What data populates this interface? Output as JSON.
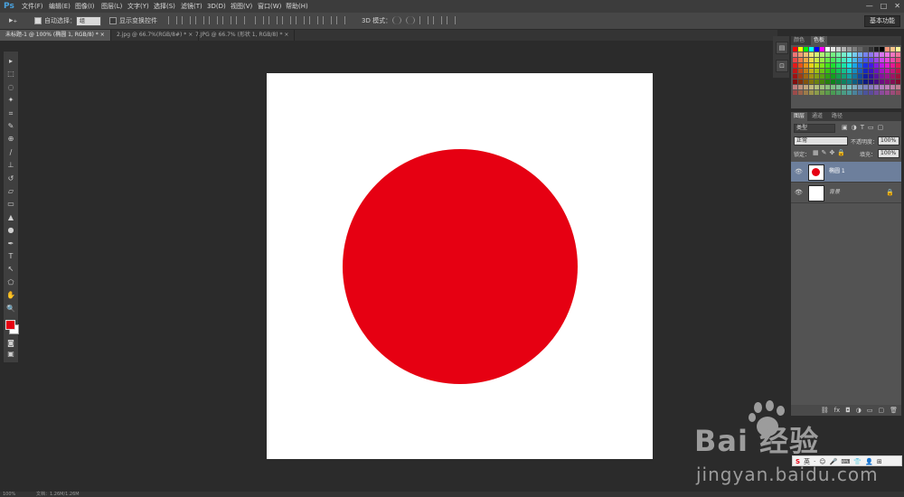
{
  "app": {
    "logo": "Ps",
    "menu": [
      "文件(F)",
      "编辑(E)",
      "图像(I)",
      "图层(L)",
      "文字(Y)",
      "选择(S)",
      "滤镜(T)",
      "3D(D)",
      "视图(V)",
      "窗口(W)",
      "帮助(H)"
    ],
    "window_controls": [
      "—",
      "□",
      "✕"
    ]
  },
  "options_bar": {
    "auto_select_label": "自动选择：",
    "auto_select_value": "组",
    "show_transform_label": "显示变换控件",
    "mode_3d_label": "3D 模式：",
    "workspace": "基本功能"
  },
  "tabs": [
    {
      "label": "未标题-1 @ 100% (椭圆 1, RGB/8) *",
      "close": "×",
      "active": true
    },
    {
      "label": "2.jpg @ 66.7%(RGB/8#) *",
      "close": "×",
      "active": false
    },
    {
      "label": "7.JPG @ 66.7% (形状 1, RGB/8) *",
      "close": "×",
      "active": false
    }
  ],
  "tools": [
    "move-tool",
    "marquee-tool",
    "lasso-tool",
    "magic-wand-tool",
    "crop-tool",
    "eyedropper-tool",
    "healing-brush-tool",
    "brush-tool",
    "clone-stamp-tool",
    "history-brush-tool",
    "eraser-tool",
    "gradient-tool",
    "blur-tool",
    "dodge-tool",
    "pen-tool",
    "type-tool",
    "path-selection-tool",
    "shape-tool",
    "hand-tool",
    "zoom-tool"
  ],
  "tool_glyphs": [
    "▸",
    "⬚",
    "◌",
    "✦",
    "⌗",
    "✎",
    "⊕",
    "∕",
    "⊥",
    "↺",
    "▱",
    "▭",
    "▲",
    "●",
    "✒",
    "T",
    "↖",
    "⬠",
    "✋",
    "🔍"
  ],
  "colors": {
    "foreground": "#e60012",
    "background": "#ffffff",
    "circle": "#e60012"
  },
  "color_panel": {
    "tabs": [
      "颜色",
      "色板"
    ],
    "active_tab": "色板"
  },
  "layers_panel": {
    "tabs": [
      "图层",
      "通道",
      "路径"
    ],
    "active_tab": "图层",
    "filter_kind": "类型",
    "blend_mode": "正常",
    "opacity_label": "不透明度：",
    "opacity_value": "100%",
    "lock_label": "锁定：",
    "fill_label": "填充：",
    "fill_value": "100%",
    "layers": [
      {
        "name": "椭圆 1",
        "selected": true,
        "visible": true,
        "locked": false
      },
      {
        "name": "背景",
        "selected": false,
        "visible": true,
        "locked": true
      }
    ],
    "footer_icons": [
      "link-icon",
      "fx-icon",
      "mask-icon",
      "adjustment-icon",
      "group-icon",
      "new-layer-icon",
      "trash-icon"
    ],
    "footer_glyphs": [
      "⛓",
      "fx",
      "◘",
      "◑",
      "▭",
      "▢",
      "🗑"
    ]
  },
  "status_bar": {
    "zoom": "100%",
    "doc_info": "文档：1.26M/1.26M"
  },
  "watermark": {
    "brand": "Bai 经验",
    "url": "jingyan.baidu.com",
    "ime_items": [
      "S",
      "英",
      "·",
      "☺",
      "🎤",
      "⌨",
      "👕",
      "👤",
      "⊞"
    ]
  }
}
